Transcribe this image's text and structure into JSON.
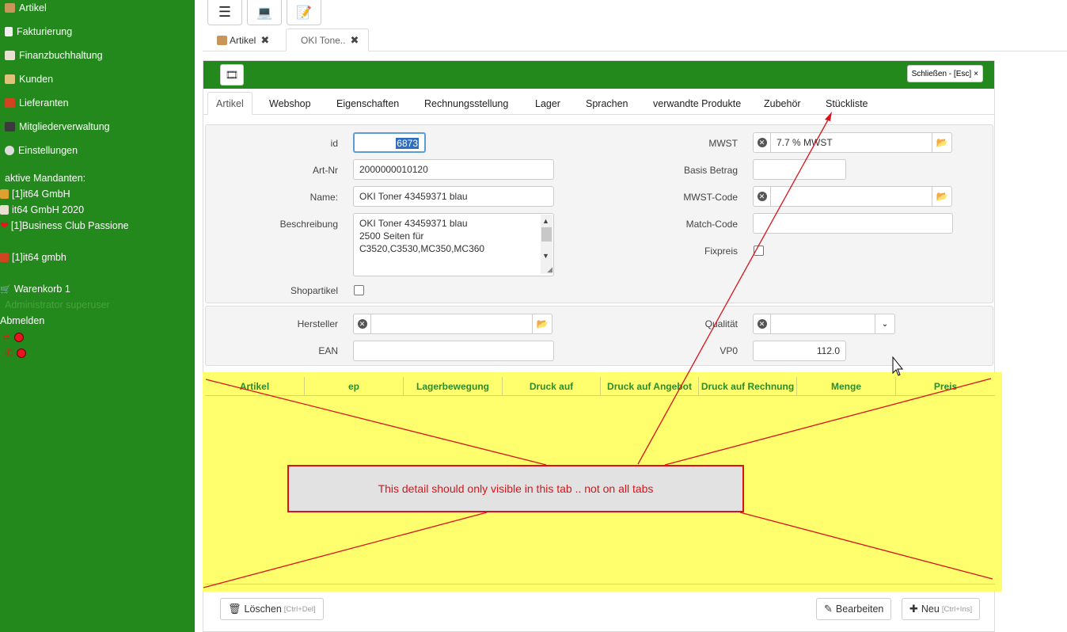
{
  "sidebar": {
    "nav": [
      {
        "label": "Artikel",
        "icon": "box-icon",
        "color": "#c8955a"
      },
      {
        "label": "Fakturierung",
        "icon": "invoice-icon",
        "color": "#f0f0f0"
      },
      {
        "label": "Finanzbuchhaltung",
        "icon": "chart-icon",
        "color": "#e8e0d0"
      },
      {
        "label": "Kunden",
        "icon": "house-icon",
        "color": "#e2c27a"
      },
      {
        "label": "Lieferanten",
        "icon": "truck-icon",
        "color": "#d04422"
      },
      {
        "label": "Mitgliederverwaltung",
        "icon": "users-icon",
        "color": "#3a3a3a"
      },
      {
        "label": "Einstellungen",
        "icon": "gear-icon",
        "color": "#dddddd"
      }
    ],
    "mandanten_title": "aktive Mandanten:",
    "mandanten": [
      {
        "label": "[1]it64 GmbH",
        "icon": "folder-icon",
        "color": "#e0a030"
      },
      {
        "label": "it64 GmbH 2020",
        "icon": "chart-icon",
        "color": "#e8e0d0"
      },
      {
        "label": "[1]Business Club Passione",
        "icon": "heart-icon",
        "color": "#e8141e"
      },
      {
        "label": "[1]it64 gmbh",
        "icon": "truck-icon",
        "color": "#d04422"
      }
    ],
    "cart": "Warenkorb 1",
    "user": "Administrator superuser",
    "logout": "Abmelden"
  },
  "toolbar": {
    "menu_icon": "☰",
    "laptop_icon": "💻",
    "notes_icon": "📝"
  },
  "doc_tabs": [
    {
      "label": "Artikel"
    },
    {
      "label": "OKI Tone.."
    }
  ],
  "panel": {
    "close_label": "Schließen - [Esc]",
    "close_x": "×",
    "tabs": [
      "Artikel",
      "Webshop",
      "Eigenschaften",
      "Rechnungsstellung",
      "Lager",
      "Sprachen",
      "verwandte Produkte",
      "Zubehör",
      "Stückliste"
    ]
  },
  "form": {
    "id_label": "id",
    "id_value": "6873",
    "artnr_label": "Art-Nr",
    "artnr_value": "2000000010120",
    "name_label": "Name:",
    "name_value": "OKI Toner 43459371 blau",
    "beschreibung_label": "Beschreibung",
    "beschreibung_lines": [
      "OKI Toner 43459371 blau",
      "2500 Seiten für",
      "C3520,C3530,MC350,MC360"
    ],
    "shopartikel_label": "Shopartikel",
    "mwst_label": "MWST",
    "mwst_value": "7.7 % MWST",
    "basis_label": "Basis Betrag",
    "basis_value": "",
    "mwstcode_label": "MWST-Code",
    "mwstcode_value": "",
    "matchcode_label": "Match-Code",
    "matchcode_value": "",
    "fixpreis_label": "Fixpreis",
    "hersteller_label": "Hersteller",
    "hersteller_value": "",
    "ean_label": "EAN",
    "ean_value": "",
    "qualitaet_label": "Qualität",
    "qualitaet_value": "",
    "vp0_label": "VP0",
    "vp0_value": "112.0"
  },
  "grid": {
    "columns": [
      "Artikel",
      "ep",
      "Lagerbewegung",
      "Druck auf",
      "Druck auf Angebot",
      "Druck auf Rechnung",
      "Menge",
      "Preis"
    ]
  },
  "annotation": {
    "text": "This detail should only visible in this tab .. not on all tabs"
  },
  "footer": {
    "delete_label": "Löschen",
    "delete_shortcut": "[Ctrl+Del]",
    "edit_label": "Bearbeiten",
    "new_label": "Neu",
    "new_shortcut": "[Ctrl+Ins]"
  },
  "colors": {
    "sidebar": "#24891d",
    "header": "#24891d",
    "highlight": "#ffff6e",
    "annotation": "#d8141a"
  }
}
